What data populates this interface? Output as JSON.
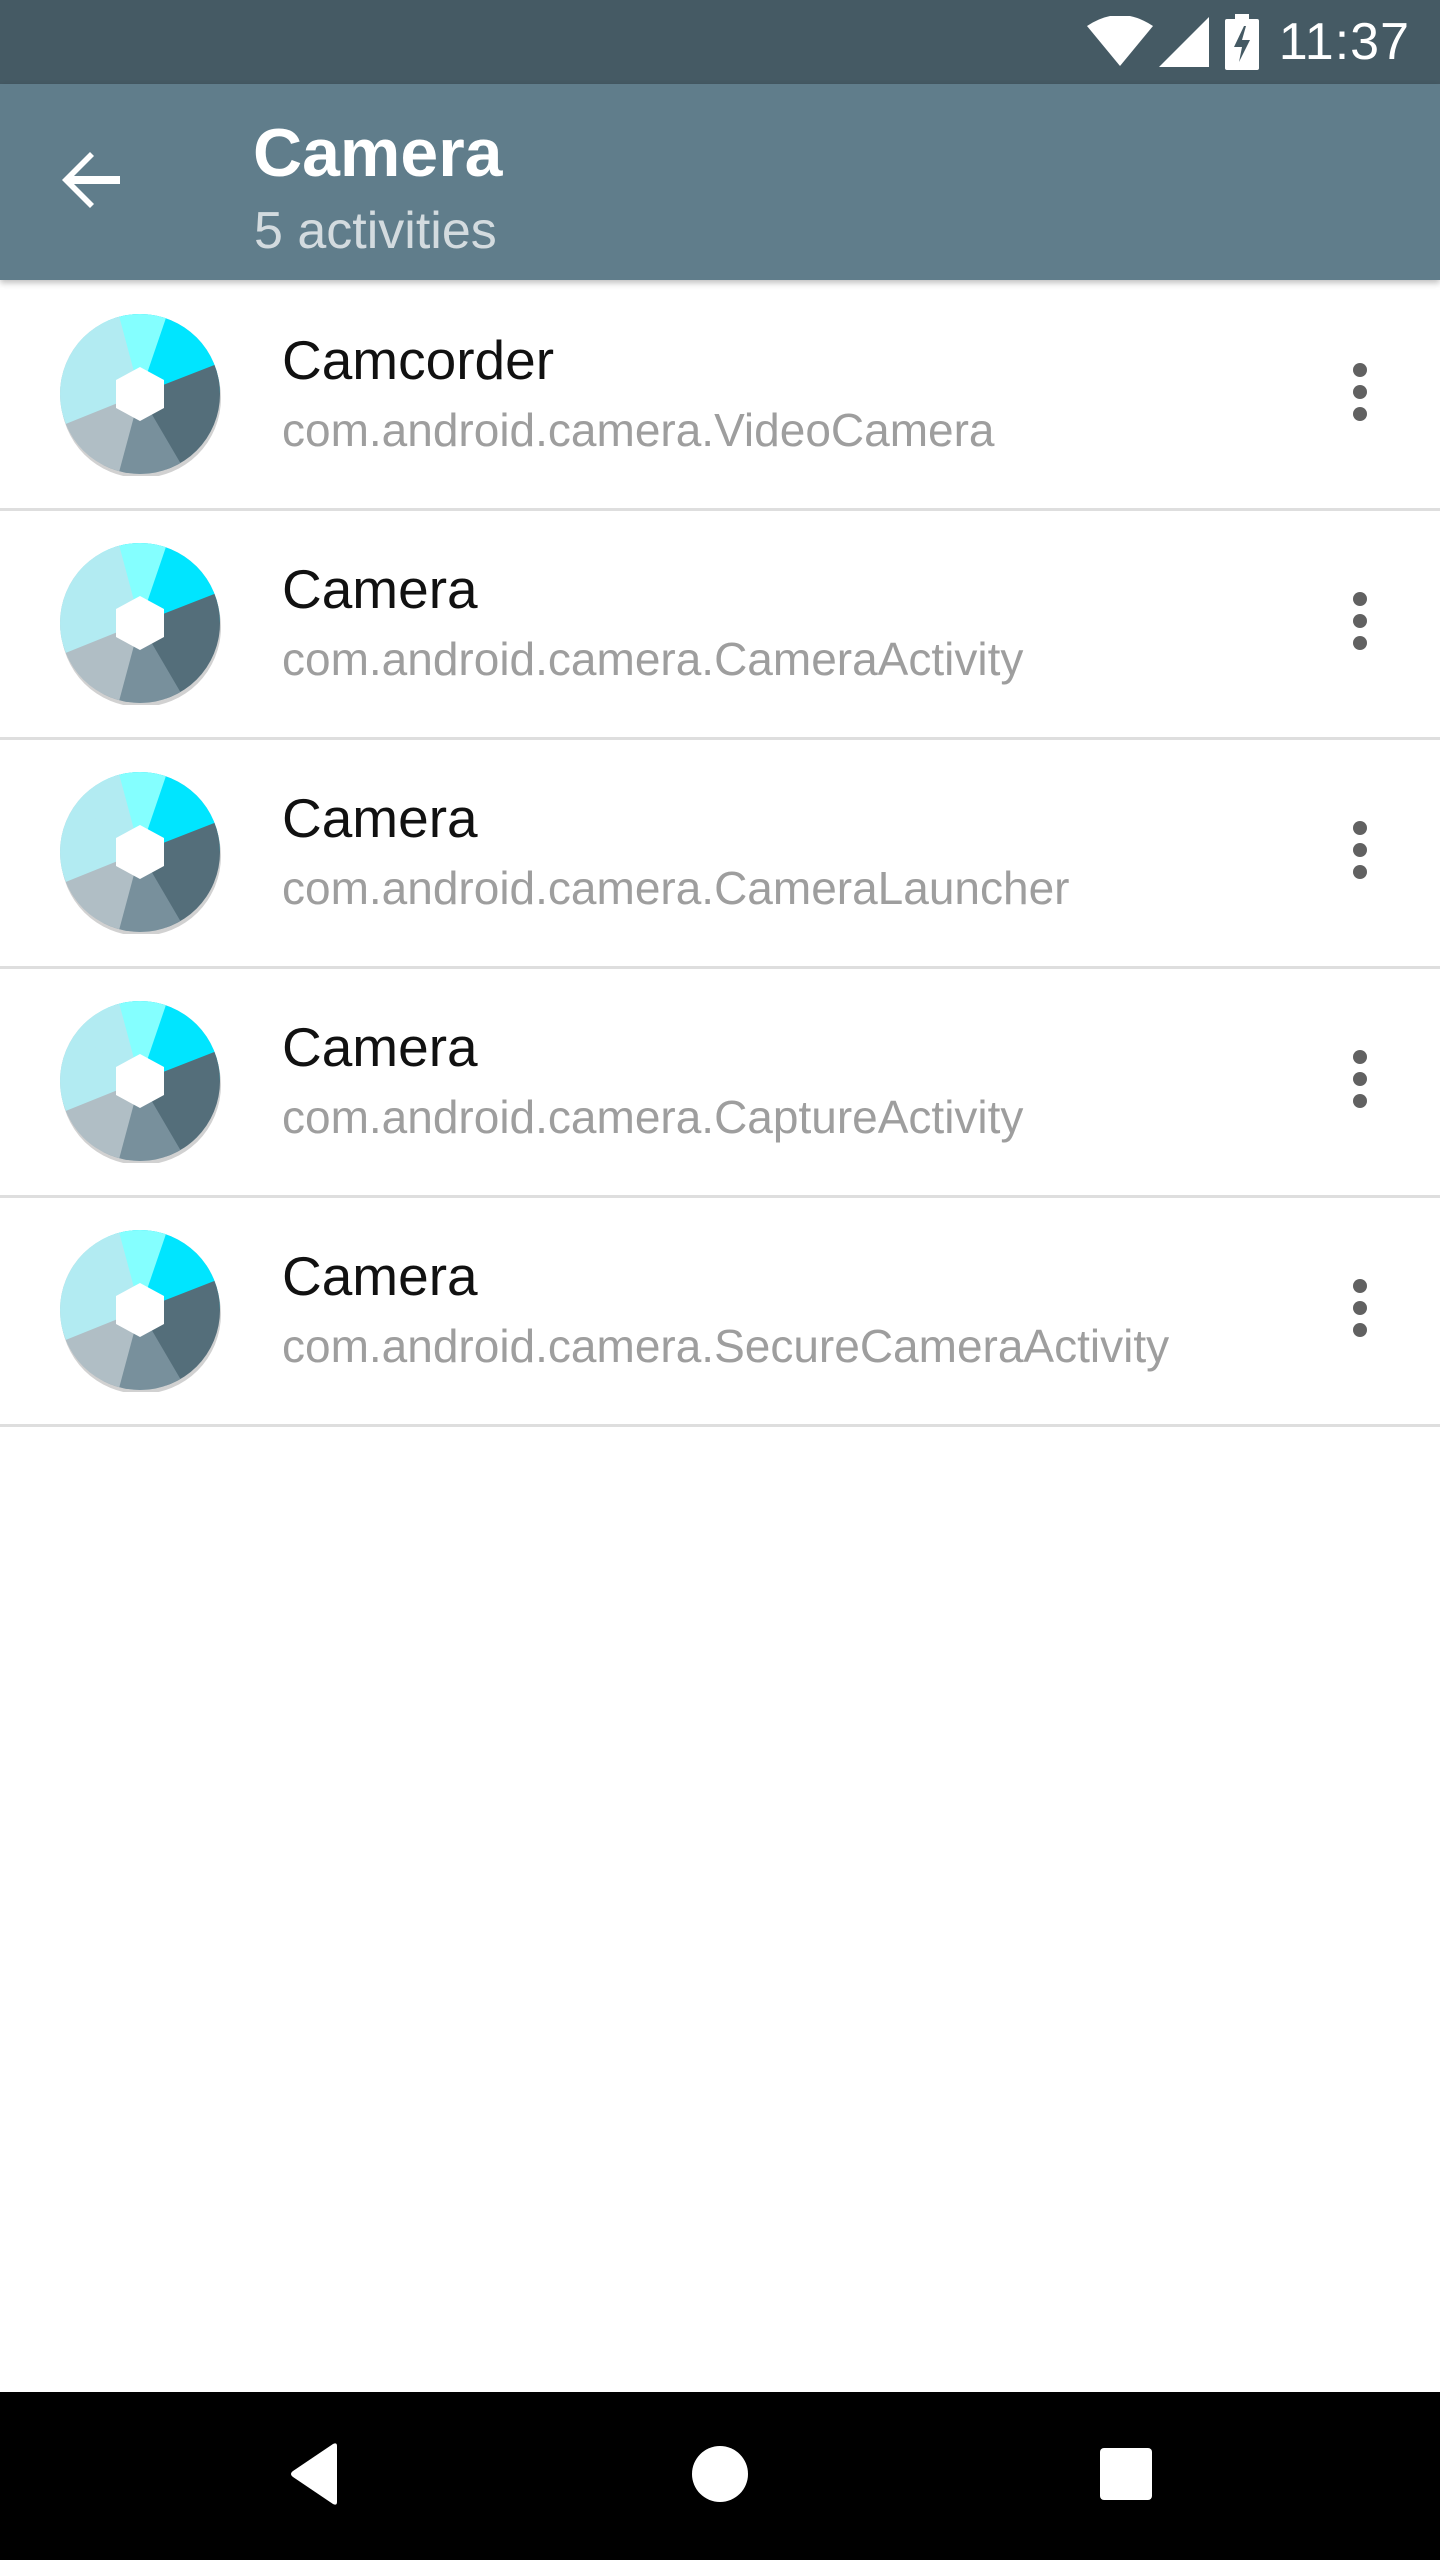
{
  "status_bar": {
    "time": "11:37",
    "icons": [
      "wifi-icon",
      "cell-signal-icon",
      "battery-charging-icon"
    ]
  },
  "app_bar": {
    "back_icon": "arrow-back-icon",
    "title": "Camera",
    "subtitle": "5 activities"
  },
  "activities": [
    {
      "title": "Camcorder",
      "subtitle": "com.android.camera.VideoCamera",
      "icon": "camera-app-icon"
    },
    {
      "title": "Camera",
      "subtitle": "com.android.camera.CameraActivity",
      "icon": "camera-app-icon"
    },
    {
      "title": "Camera",
      "subtitle": "com.android.camera.CameraLauncher",
      "icon": "camera-app-icon"
    },
    {
      "title": "Camera",
      "subtitle": "com.android.camera.CaptureActivity",
      "icon": "camera-app-icon"
    },
    {
      "title": "Camera",
      "subtitle": "com.android.camera.SecureCameraActivity",
      "icon": "camera-app-icon"
    }
  ],
  "nav_bar": {
    "icons": [
      "back-triangle-icon",
      "home-circle-icon",
      "recents-square-icon"
    ]
  },
  "colors": {
    "status_bar": "#455a64",
    "app_bar": "#607d8b",
    "secondary_text": "#9e9e9e",
    "divider": "#dedede"
  }
}
